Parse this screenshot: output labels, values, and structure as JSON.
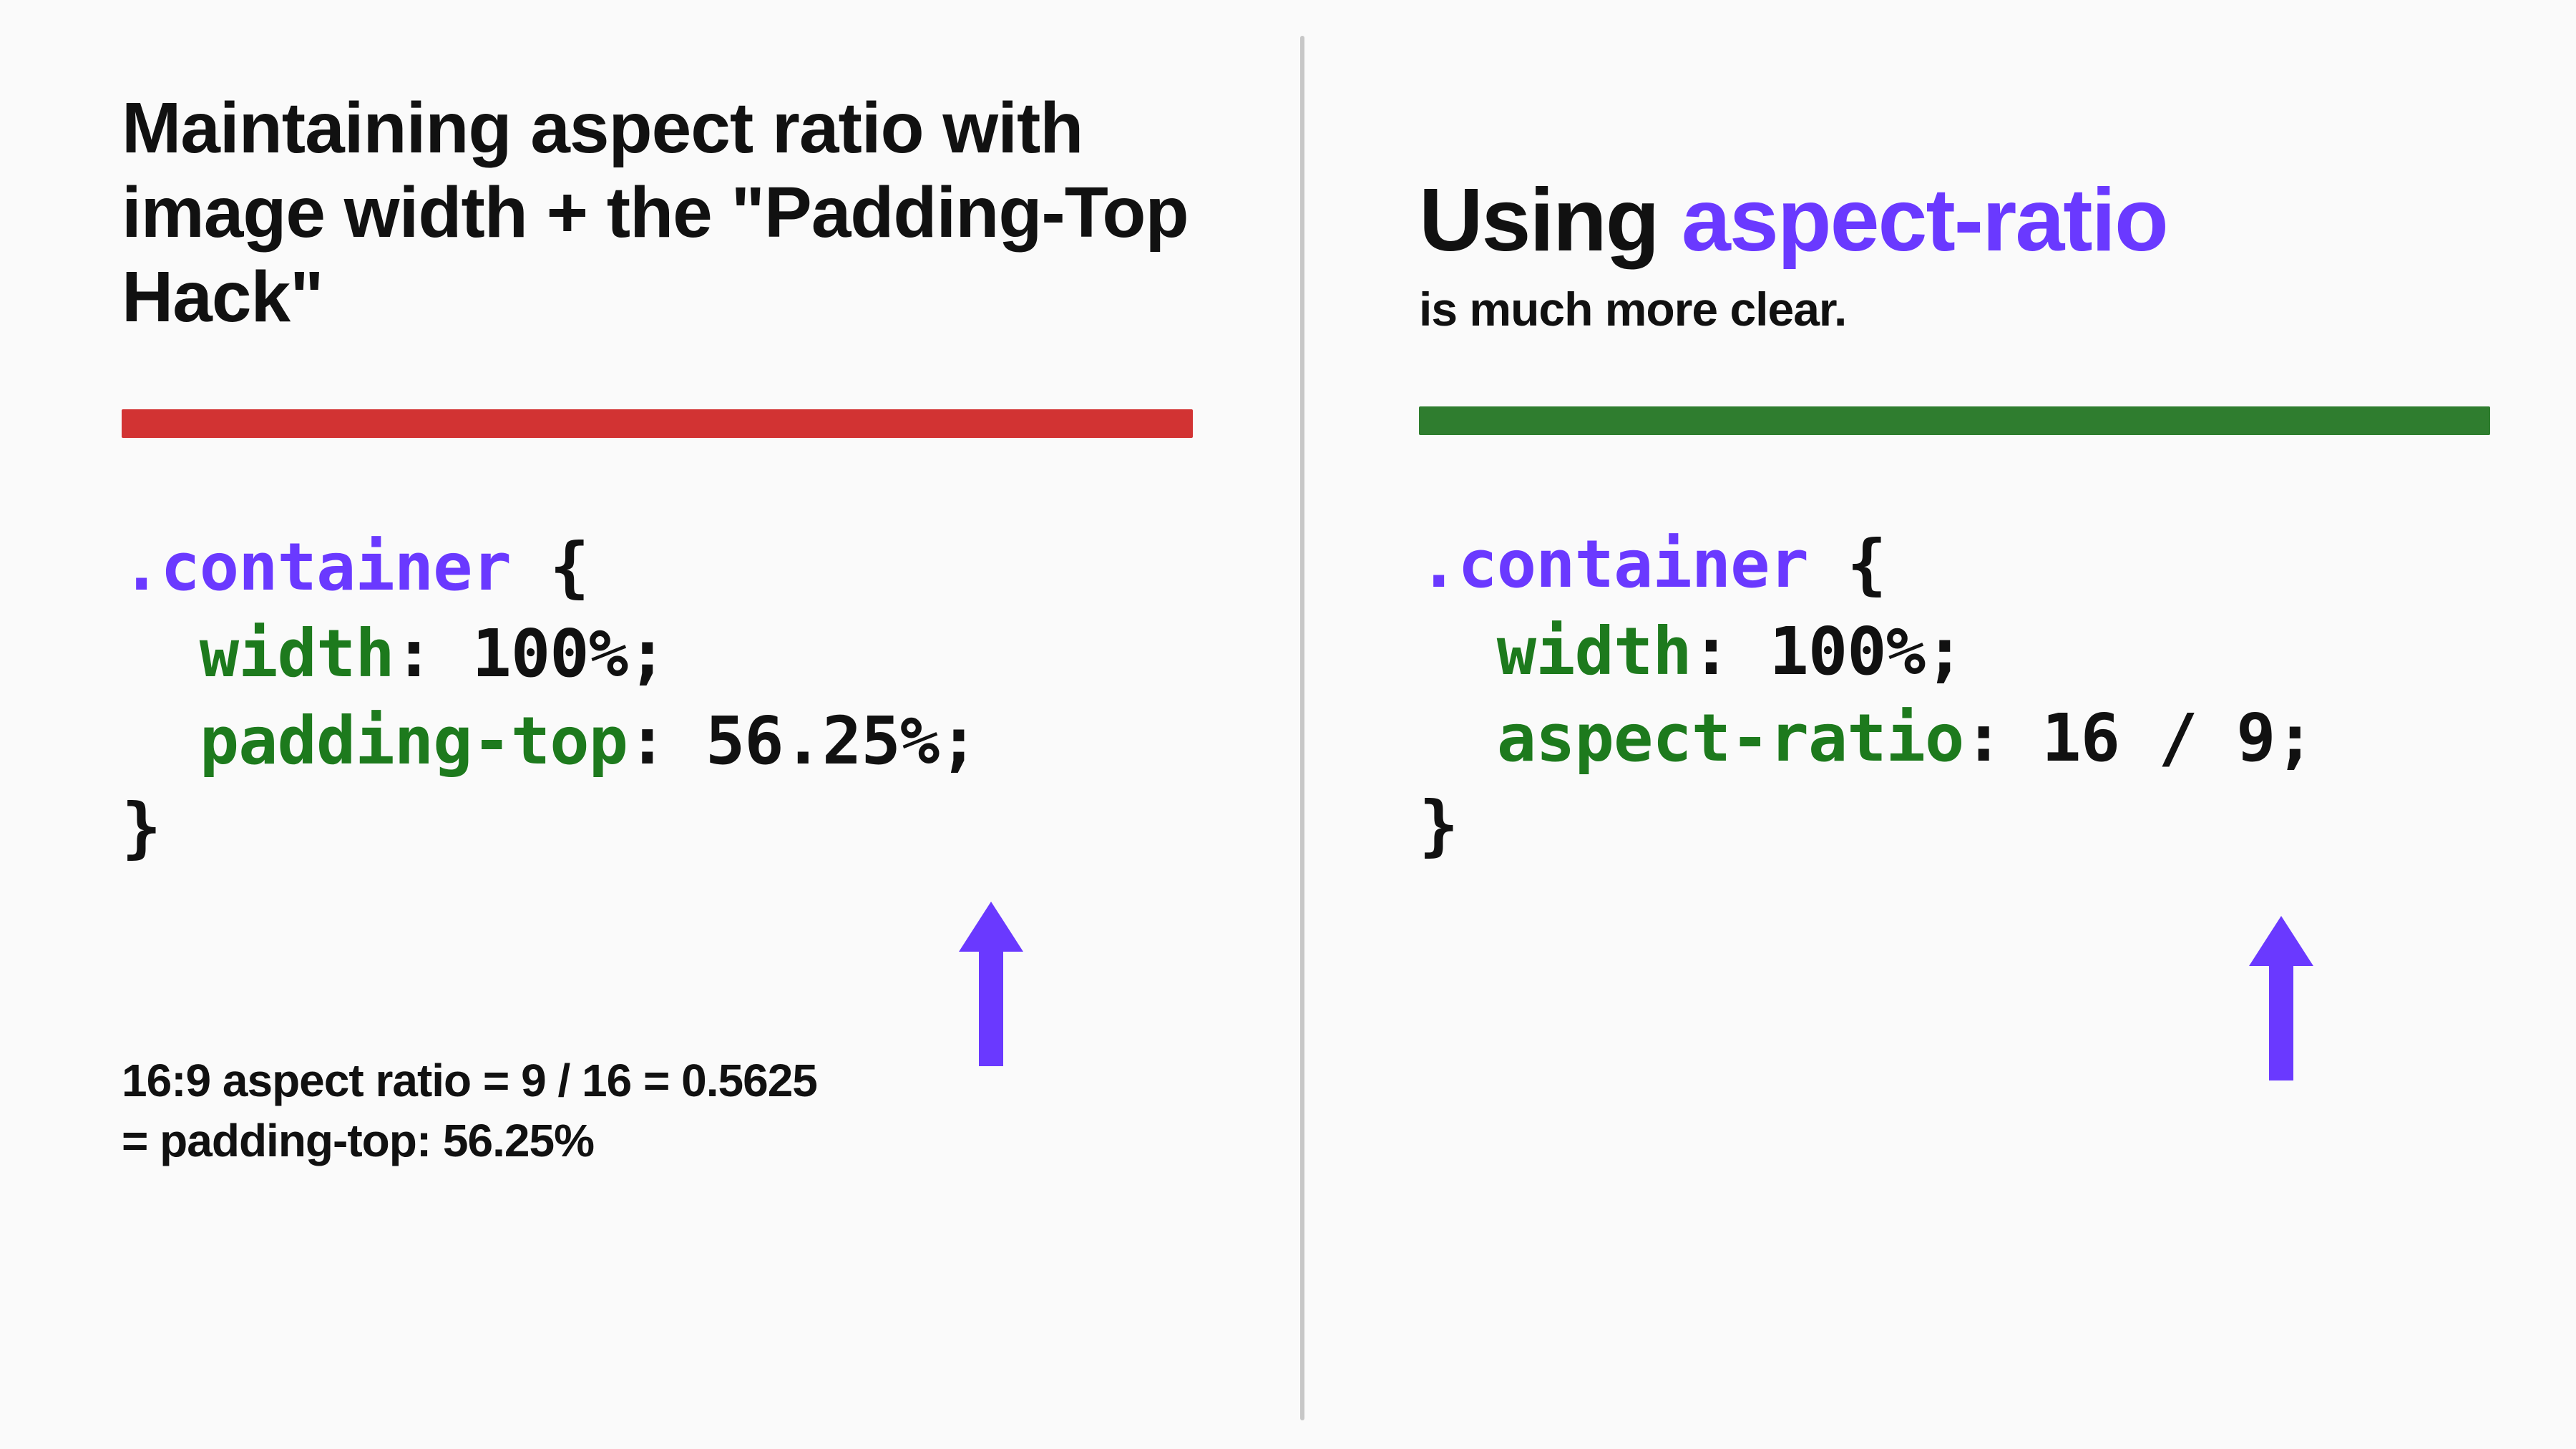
{
  "left": {
    "heading": "Maintaining aspect ratio with image width + the \"Padding-Top Hack\"",
    "code": {
      "selector": ".container",
      "open": " {",
      "indent": "  ",
      "prop1": "width",
      "val1": "100%",
      "prop2": "padding-top",
      "val2": "56.25%",
      "close": "}"
    },
    "explain_line1": "16:9 aspect ratio = 9 / 16  = 0.5625",
    "explain_line2": "= padding-top: 56.25%"
  },
  "right": {
    "heading_prefix": "Using ",
    "heading_accent": "aspect-ratio",
    "subheading": "is much more clear.",
    "code": {
      "selector": ".container",
      "open": " {",
      "indent": "  ",
      "prop1": "width",
      "val1": "100%",
      "prop2": "aspect-ratio",
      "val2": "16 / 9",
      "close": "}"
    }
  },
  "colors": {
    "rule_red": "#d23333",
    "rule_green": "#2f7d2f",
    "accent": "#6a39ff",
    "prop": "#1d7a1d"
  }
}
